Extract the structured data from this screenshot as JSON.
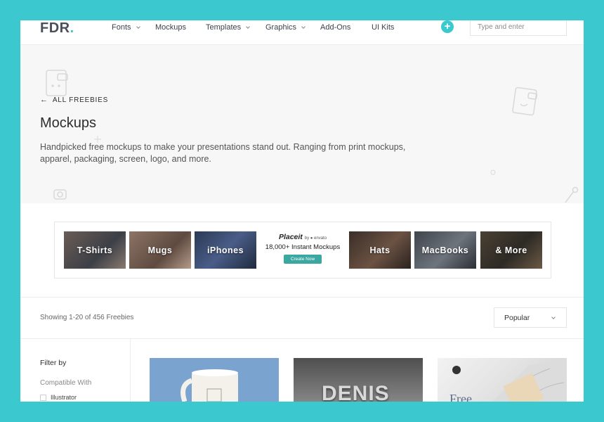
{
  "header": {
    "logo_text": "FDR",
    "logo_dot": ".",
    "nav": [
      {
        "label": "Fonts",
        "dropdown": true
      },
      {
        "label": "Mockups",
        "dropdown": false
      },
      {
        "label": "Templates",
        "dropdown": true
      },
      {
        "label": "Graphics",
        "dropdown": true
      },
      {
        "label": "Add-Ons",
        "dropdown": false
      },
      {
        "label": "UI Kits",
        "dropdown": false
      }
    ],
    "add_icon": "+",
    "search_placeholder": "Type and enter"
  },
  "hero": {
    "back_label": "ALL FREEBIES",
    "title": "Mockups",
    "description": "Handpicked free mockups to make your presentations stand out. Ranging from print mockups, apparel, packaging, screen, logo, and more."
  },
  "banner": {
    "tiles": [
      "T-Shirts",
      "Mugs",
      "iPhones",
      "Hats",
      "MacBooks",
      "& More"
    ],
    "placeit": {
      "brand": "Placeit",
      "by": "by ● envato",
      "count": "18,000+ Instant Mockups",
      "cta": "Create Now"
    }
  },
  "results": {
    "showing": "Showing 1-20 of 456 Freebies",
    "sort_value": "Popular"
  },
  "filter": {
    "title": "Filter by",
    "compat_label": "Compatible With",
    "options": [
      "Illustrator"
    ]
  },
  "cards": [
    {
      "title": ""
    },
    {
      "title": "DENIS"
    },
    {
      "title": "Free"
    }
  ],
  "colors": {
    "accent": "#3cc8cf",
    "cta": "#3aa7a0"
  }
}
